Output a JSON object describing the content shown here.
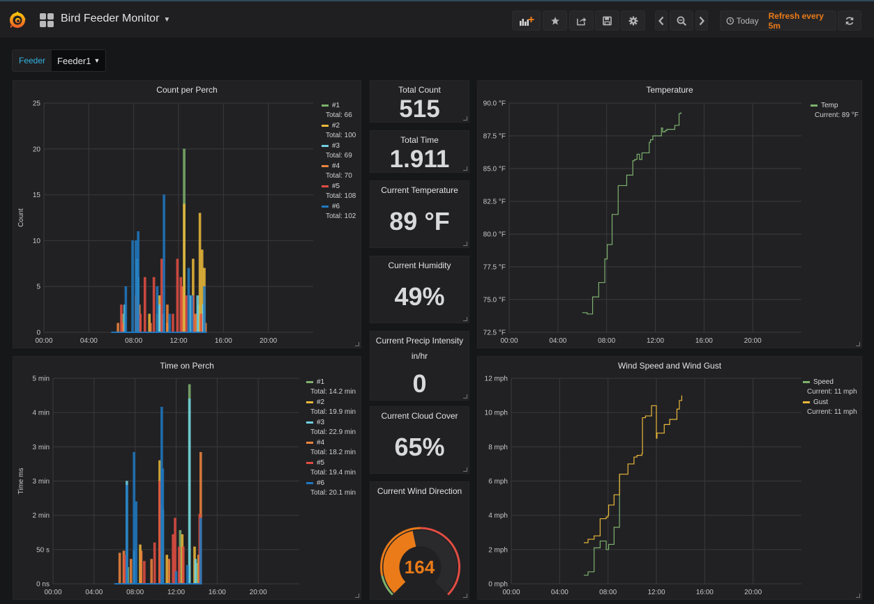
{
  "header": {
    "title": "Bird Feeder Monitor",
    "time_range": "Today",
    "refresh": "Refresh every 5m",
    "buttons": [
      "add-panel",
      "star",
      "share",
      "save",
      "settings",
      "time-back",
      "zoom-out",
      "time-forward",
      "refresh"
    ]
  },
  "variables": [
    {
      "label": "Feeder",
      "value": "Feeder1"
    }
  ],
  "colors": {
    "series": [
      "#7eb26d",
      "#eab839",
      "#6ed0e0",
      "#ef843c",
      "#e24d42",
      "#1f78c1"
    ],
    "gauge_value": "#eb7b18",
    "refresh_text": "#eb7b18",
    "variable_label": "#33b5e5"
  },
  "stats": {
    "total_count": {
      "title": "Total Count",
      "value": "515"
    },
    "total_time": {
      "title": "Total Time",
      "value": "1.911"
    },
    "current_temperature": {
      "title": "Current Temperature",
      "value": "89 °F"
    },
    "current_humidity": {
      "title": "Current Humidity",
      "value": "49%"
    },
    "current_precip": {
      "title": "Current Precip Intensity",
      "subtitle": "in/hr",
      "value": "0"
    },
    "current_cloud": {
      "title": "Current Cloud Cover",
      "value": "65%"
    },
    "wind_direction": {
      "title": "Current Wind Direction",
      "value": "164",
      "gauge_min": 0,
      "gauge_max": 360,
      "gauge_fraction": 0.456
    }
  },
  "chart_data": [
    {
      "id": "count_per_perch",
      "type": "bar",
      "title": "Count per Perch",
      "xlabel": "",
      "ylabel": "Count",
      "xlim": [
        0,
        24
      ],
      "ylim": [
        0,
        25
      ],
      "xticks": [
        "00:00",
        "04:00",
        "08:00",
        "12:00",
        "16:00",
        "20:00"
      ],
      "yticks": [
        "0",
        "5",
        "10",
        "15",
        "20",
        "25"
      ],
      "grid": true,
      "legend": "right",
      "series": [
        {
          "name": "#1",
          "legend_value": "Total: 66",
          "points": [
            [
              7.0,
              2
            ],
            [
              8.3,
              1
            ],
            [
              10.1,
              2
            ],
            [
              12.5,
              20
            ],
            [
              13.0,
              4
            ],
            [
              13.8,
              3
            ],
            [
              14.0,
              2
            ]
          ]
        },
        {
          "name": "#2",
          "legend_value": "Total: 100",
          "points": [
            [
              9.4,
              2
            ],
            [
              10.3,
              4
            ],
            [
              11.0,
              1
            ],
            [
              12.5,
              14
            ],
            [
              13.3,
              8
            ],
            [
              13.9,
              13
            ],
            [
              14.1,
              9
            ],
            [
              14.3,
              7
            ]
          ]
        },
        {
          "name": "#3",
          "legend_value": "Total: 69",
          "points": [
            [
              7.2,
              3
            ],
            [
              8.3,
              8
            ],
            [
              8.4,
              6
            ],
            [
              10.3,
              3
            ],
            [
              10.6,
              2
            ],
            [
              13.1,
              4
            ],
            [
              13.7,
              4
            ],
            [
              14.2,
              3
            ]
          ]
        },
        {
          "name": "#4",
          "legend_value": "Total: 70",
          "points": [
            [
              6.6,
              1
            ],
            [
              7.0,
              1
            ],
            [
              8.2,
              4
            ],
            [
              8.5,
              3
            ],
            [
              9.5,
              1
            ],
            [
              11.0,
              3
            ],
            [
              12.3,
              5
            ],
            [
              13.5,
              2
            ],
            [
              14.4,
              1
            ]
          ]
        },
        {
          "name": "#5",
          "legend_value": "Total: 108",
          "points": [
            [
              6.9,
              3
            ],
            [
              8.6,
              2
            ],
            [
              9.0,
              6
            ],
            [
              9.8,
              6
            ],
            [
              10.5,
              8
            ],
            [
              11.5,
              2
            ],
            [
              11.9,
              8
            ],
            [
              12.2,
              6
            ],
            [
              12.7,
              4
            ],
            [
              13.3,
              4
            ],
            [
              14.0,
              2
            ]
          ]
        },
        {
          "name": "#6",
          "legend_value": "Total: 102",
          "points": [
            [
              6.1,
              0
            ],
            [
              7.3,
              5
            ],
            [
              7.9,
              10
            ],
            [
              8.2,
              10
            ],
            [
              8.4,
              11
            ],
            [
              10.1,
              5
            ],
            [
              10.7,
              15
            ],
            [
              11.2,
              2
            ],
            [
              12.9,
              7
            ],
            [
              13.2,
              4
            ],
            [
              14.3,
              5
            ]
          ]
        }
      ]
    },
    {
      "id": "time_on_perch",
      "type": "bar",
      "title": "Time on Perch",
      "xlabel": "",
      "ylabel": "Time ms",
      "xlim": [
        0,
        24
      ],
      "ylim": [
        0,
        5
      ],
      "yunit": "min",
      "xticks": [
        "00:00",
        "04:00",
        "08:00",
        "12:00",
        "16:00",
        "20:00"
      ],
      "yticks": [
        "0 ns",
        "50 s",
        "2 min",
        "3 min",
        "3 min",
        "4 min",
        "5 min"
      ],
      "grid": true,
      "legend": "right",
      "series": [
        {
          "name": "#1",
          "legend_value": "Total: 14.2 min",
          "points": [
            [
              7.3,
              0.4
            ],
            [
              10.6,
              1.9
            ],
            [
              12.4,
              1.3
            ],
            [
              13.3,
              4.85
            ],
            [
              14.0,
              0.5
            ]
          ]
        },
        {
          "name": "#2",
          "legend_value": "Total: 19.9 min",
          "points": [
            [
              8.5,
              0.95
            ],
            [
              10.4,
              3.0
            ],
            [
              11.1,
              0.7
            ],
            [
              12.6,
              1.2
            ],
            [
              13.8,
              0.9
            ],
            [
              14.2,
              0.7
            ]
          ]
        },
        {
          "name": "#3",
          "legend_value": "Total: 22.9 min",
          "points": [
            [
              7.2,
              2.5
            ],
            [
              7.9,
              0.8
            ],
            [
              10.7,
              1.8
            ],
            [
              13.3,
              4.5
            ],
            [
              13.9,
              0.6
            ]
          ]
        },
        {
          "name": "#4",
          "legend_value": "Total: 18.2 min",
          "points": [
            [
              6.5,
              0.75
            ],
            [
              6.9,
              0.8
            ],
            [
              7.6,
              0.6
            ],
            [
              8.6,
              0.8
            ],
            [
              9.6,
              0.6
            ],
            [
              11.3,
              0.6
            ],
            [
              14.4,
              3.2
            ]
          ]
        },
        {
          "name": "#5",
          "legend_value": "Total: 19.4 min",
          "points": [
            [
              7.0,
              0.7
            ],
            [
              8.9,
              0.55
            ],
            [
              9.9,
              1.0
            ],
            [
              10.4,
              2.5
            ],
            [
              11.7,
              1.2
            ],
            [
              11.9,
              1.6
            ],
            [
              12.3,
              0.9
            ],
            [
              12.7,
              0.9
            ],
            [
              14.3,
              1.7
            ]
          ]
        },
        {
          "name": "#6",
          "legend_value": "Total: 20.1 min",
          "points": [
            [
              6.1,
              0
            ],
            [
              7.2,
              2.4
            ],
            [
              7.9,
              3.2
            ],
            [
              8.1,
              2.0
            ],
            [
              10.6,
              4.3
            ],
            [
              10.7,
              2.8
            ],
            [
              12.0,
              0.3
            ],
            [
              13.1,
              0.45
            ],
            [
              14.4,
              1.6
            ]
          ]
        }
      ]
    },
    {
      "id": "temperature",
      "type": "line",
      "title": "Temperature",
      "xlabel": "",
      "ylabel": "",
      "xlim": [
        0,
        24
      ],
      "ylim": [
        72.5,
        90.0
      ],
      "xticks": [
        "00:00",
        "04:00",
        "08:00",
        "12:00",
        "16:00",
        "20:00"
      ],
      "yticks": [
        "72.5 °F",
        "75.0 °F",
        "77.5 °F",
        "80.0 °F",
        "82.5 °F",
        "85.0 °F",
        "87.5 °F",
        "90.0 °F"
      ],
      "grid": true,
      "legend": "right",
      "series": [
        {
          "name": "Temp",
          "legend_value": "Current: 89 °F",
          "step": true,
          "x": [
            6.0,
            6.3,
            6.4,
            6.8,
            6.85,
            7.3,
            7.35,
            7.8,
            7.85,
            8.0,
            8.05,
            8.4,
            8.45,
            8.9,
            8.95,
            9.6,
            9.65,
            10.1,
            10.15,
            10.3,
            10.5,
            10.7,
            10.9,
            11.1,
            11.5,
            11.6,
            11.8,
            11.9,
            12.0,
            12.4,
            12.5,
            12.6,
            12.8,
            12.95,
            13.1,
            13.4,
            13.6,
            13.7,
            13.95,
            14.1
          ],
          "y": [
            74.0,
            74.0,
            73.9,
            73.9,
            75.2,
            75.2,
            76.3,
            76.3,
            78.1,
            78.1,
            79.2,
            79.2,
            81.5,
            81.5,
            83.7,
            83.7,
            84.5,
            84.5,
            85.6,
            85.7,
            86.1,
            85.7,
            86.2,
            86.2,
            87.0,
            87.2,
            87.5,
            87.5,
            87.5,
            87.5,
            88.1,
            87.8,
            87.9,
            88.0,
            88.0,
            88.0,
            88.3,
            88.3,
            89.2,
            89.3
          ]
        }
      ]
    },
    {
      "id": "wind",
      "type": "line",
      "title": "Wind Speed and Wind Gust",
      "xlabel": "",
      "ylabel": "",
      "xlim": [
        0,
        24
      ],
      "ylim": [
        0,
        12
      ],
      "xticks": [
        "00:00",
        "04:00",
        "08:00",
        "12:00",
        "16:00",
        "20:00"
      ],
      "yticks": [
        "0 mph",
        "2 mph",
        "4 mph",
        "6 mph",
        "8 mph",
        "10 mph",
        "12 mph"
      ],
      "grid": true,
      "legend": "right",
      "series": [
        {
          "name": "Speed",
          "legend_value": "Current: 11 mph",
          "step": true,
          "x": [
            6.0,
            6.3,
            6.35,
            6.8,
            6.85,
            7.3,
            7.35,
            7.8,
            7.85,
            8.0,
            8.05,
            8.45,
            8.5,
            8.9,
            8.95
          ],
          "y": [
            0.5,
            0.5,
            0.7,
            0.7,
            2.1,
            2.1,
            2.5,
            2.5,
            2.0,
            2.0,
            2.3,
            2.3,
            3.3,
            3.3,
            6.4
          ]
        },
        {
          "name": "Gust",
          "legend_value": "Current: 11 mph",
          "step": true,
          "x": [
            6.0,
            6.3,
            6.35,
            6.8,
            6.85,
            7.3,
            7.35,
            7.8,
            7.85,
            8.0,
            8.05,
            8.45,
            8.5,
            8.9,
            8.95,
            9.6,
            9.65,
            10.1,
            10.15,
            10.4,
            10.45,
            10.8,
            10.85,
            11.1,
            11.5,
            11.6,
            11.75,
            12.0,
            12.05,
            12.6,
            12.65,
            13.0,
            13.1,
            13.6,
            13.7,
            13.9,
            14.1
          ],
          "y": [
            2.4,
            2.4,
            2.6,
            2.6,
            2.8,
            2.8,
            3.8,
            3.8,
            3.9,
            4.0,
            4.6,
            4.6,
            5.2,
            5.2,
            6.4,
            6.4,
            7.0,
            7.0,
            7.4,
            7.5,
            7.5,
            7.6,
            9.7,
            9.8,
            9.8,
            10.4,
            10.4,
            8.5,
            8.8,
            8.8,
            9.3,
            9.3,
            9.6,
            9.6,
            10.2,
            10.7,
            11.0
          ]
        }
      ]
    }
  ]
}
